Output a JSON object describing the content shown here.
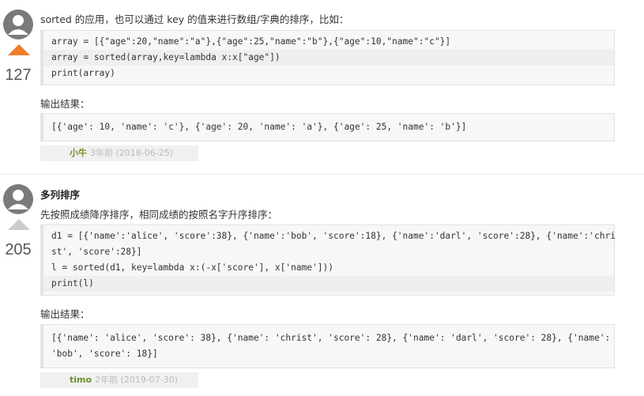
{
  "answers": [
    {
      "vote_count": "127",
      "intro": "sorted 的应用，也可以通过 key 的值来进行数组/字典的排序，比如：",
      "code_lines": [
        "array = [{\"age\":20,\"name\":\"a\"},{\"age\":25,\"name\":\"b\"},{\"age\":10,\"name\":\"c\"}]",
        "array = sorted(array,key=lambda x:x[\"age\"])",
        "print(array)"
      ],
      "output_label": "输出结果：",
      "output_lines": [
        "[{'age': 10, 'name': 'c'}, {'age': 20, 'name': 'a'}, {'age': 25, 'name': 'b'}]"
      ],
      "author": "小牛",
      "date": "3年前 (2018-06-25)"
    },
    {
      "vote_count": "205",
      "heading": "多列排序",
      "intro": "先按照成绩降序排序，相同成绩的按照名字升序排序：",
      "code_lines": [
        "d1 = [{'name':'alice', 'score':38}, {'name':'bob', 'score':18}, {'name':'darl', 'score':28}, {'name':'chri",
        "st', 'score':28}]",
        "l = sorted(d1, key=lambda x:(-x['score'], x['name']))",
        "print(l)"
      ],
      "output_label": "输出结果：",
      "output_lines": [
        "[{'name': 'alice', 'score': 38}, {'name': 'christ', 'score': 28}, {'name': 'darl', 'score': 28}, {'name':",
        "'bob', 'score': 18}]"
      ],
      "author": "timo",
      "date": "2年前 (2019-07-30)"
    }
  ],
  "colors": {
    "upvote_active": "#f07c2a",
    "upvote_inactive": "#cccccc",
    "author": "#6b8f2a"
  },
  "icons": {
    "avatar": "avatar-icon",
    "upvote": "upvote-arrow-icon"
  }
}
